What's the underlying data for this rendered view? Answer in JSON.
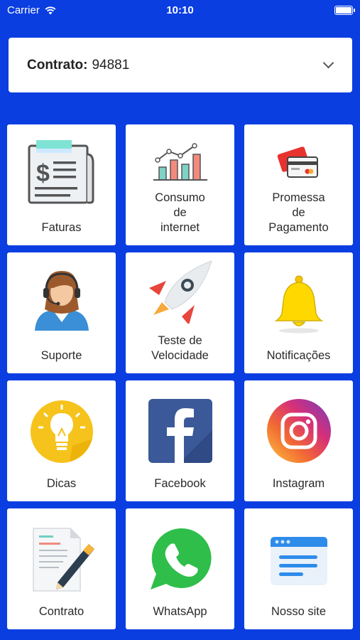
{
  "status_bar": {
    "carrier": "Carrier",
    "time": "10:10"
  },
  "contract": {
    "label": "Contrato:",
    "number": "94881"
  },
  "tiles": [
    {
      "id": "faturas",
      "label": "Faturas",
      "icon": "invoice-icon"
    },
    {
      "id": "consumo",
      "label": "Consumo\nde\ninternet",
      "icon": "bar-chart-icon"
    },
    {
      "id": "promessa",
      "label": "Promessa\nde\nPagamento",
      "icon": "credit-cards-icon"
    },
    {
      "id": "suporte",
      "label": "Suporte",
      "icon": "support-agent-icon"
    },
    {
      "id": "teste",
      "label": "Teste de\nVelocidade",
      "icon": "rocket-icon"
    },
    {
      "id": "notificacoes",
      "label": "Notificações",
      "icon": "bell-icon"
    },
    {
      "id": "dicas",
      "label": "Dicas",
      "icon": "lightbulb-icon"
    },
    {
      "id": "facebook",
      "label": "Facebook",
      "icon": "facebook-icon"
    },
    {
      "id": "instagram",
      "label": "Instagram",
      "icon": "instagram-icon"
    },
    {
      "id": "contrato",
      "label": "Contrato",
      "icon": "document-pen-icon"
    },
    {
      "id": "whatsapp",
      "label": "WhatsApp",
      "icon": "whatsapp-icon"
    },
    {
      "id": "site",
      "label": "Nosso site",
      "icon": "browser-window-icon"
    }
  ],
  "colors": {
    "background": "#0a3ee0",
    "tile": "#ffffff"
  }
}
